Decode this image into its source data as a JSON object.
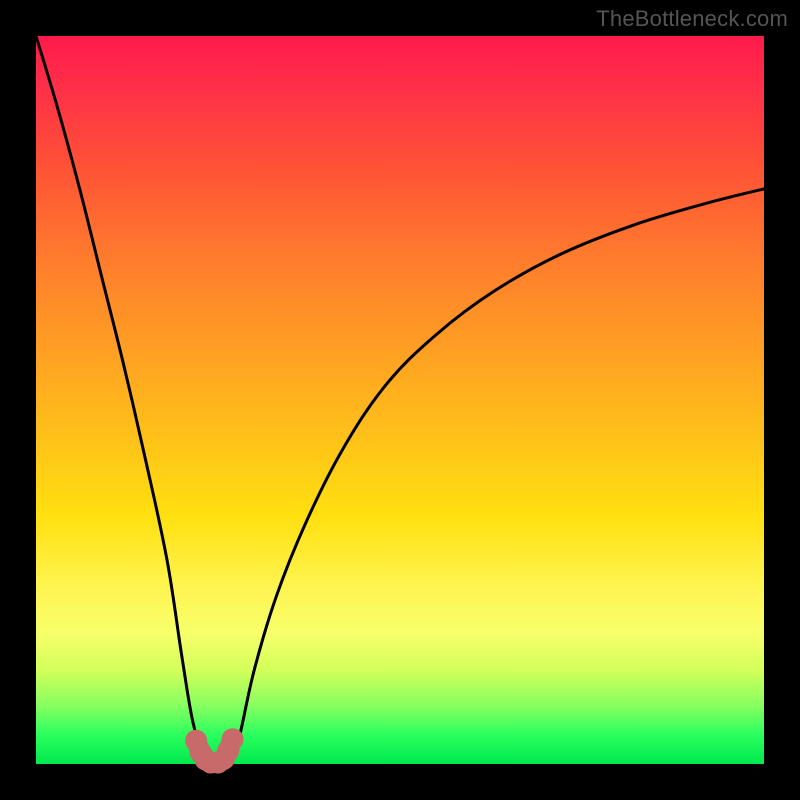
{
  "watermark": "TheBottleneck.com",
  "chart_data": {
    "type": "line",
    "title": "",
    "xlabel": "",
    "ylabel": "",
    "xlim": [
      0,
      100
    ],
    "ylim": [
      0,
      100
    ],
    "grid": false,
    "series": [
      {
        "name": "bottleneck-curve",
        "x": [
          0,
          3,
          6,
          9,
          12,
          15,
          18,
          20,
          21.5,
          23,
          24,
          25,
          26,
          27,
          28,
          30,
          33,
          37,
          42,
          48,
          55,
          63,
          72,
          82,
          92,
          100
        ],
        "y": [
          100,
          90,
          79,
          67,
          55,
          42,
          28,
          15,
          6,
          1,
          0,
          0,
          0,
          1,
          4,
          13,
          23,
          33,
          43,
          52,
          59,
          65,
          70,
          74,
          77,
          79
        ]
      },
      {
        "name": "highlight-dots",
        "x": [
          22.0,
          22.6,
          23.3,
          24.0,
          25.0,
          25.8,
          26.4,
          27.0
        ],
        "y": [
          3.2,
          1.6,
          0.6,
          0.2,
          0.2,
          0.7,
          1.8,
          3.4
        ]
      }
    ],
    "colors": {
      "curve": "#000000",
      "dots": "#c96a6a",
      "gradient_top": "#ff1a4b",
      "gradient_bottom": "#00e84e"
    }
  }
}
